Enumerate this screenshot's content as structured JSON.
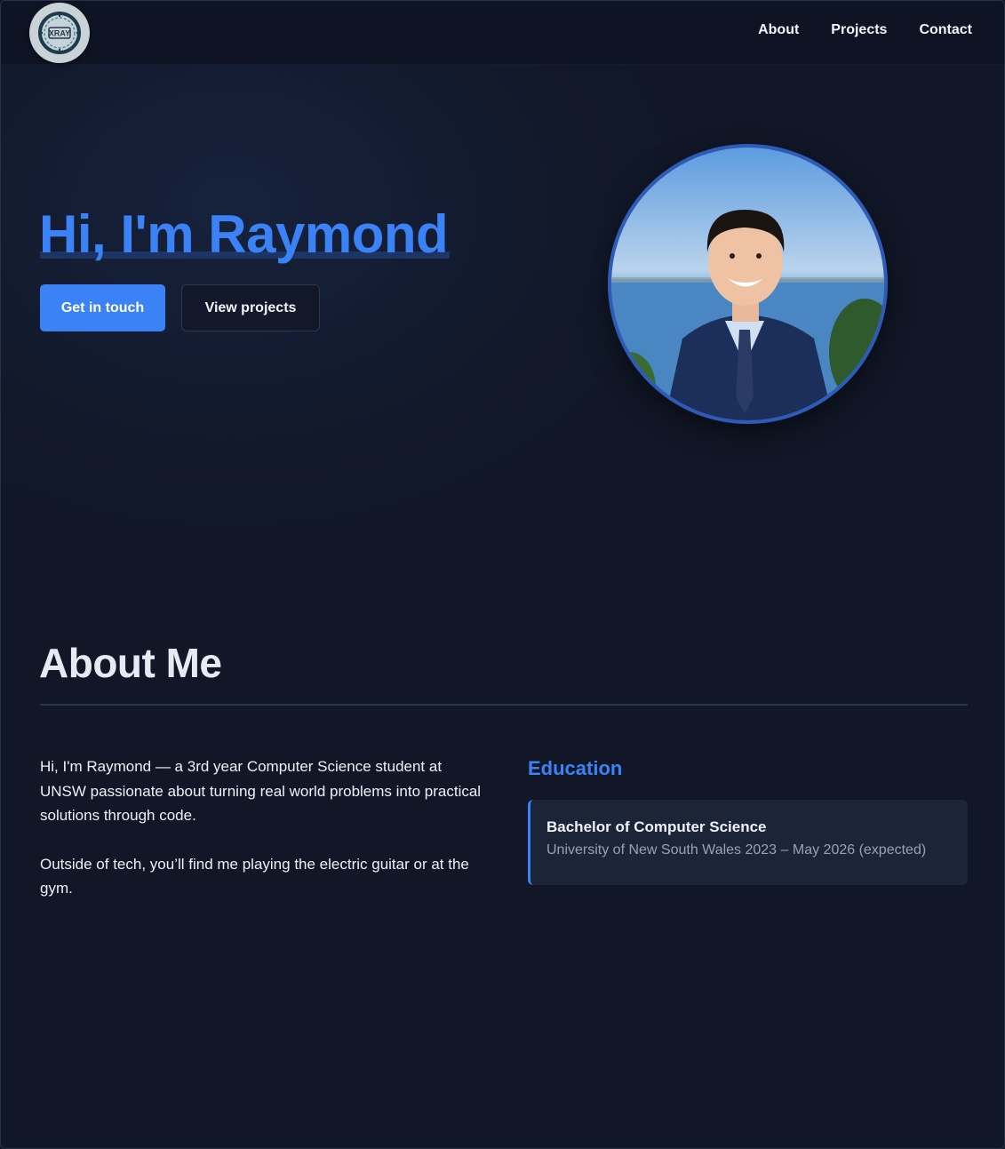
{
  "header": {
    "logo_text": "XRAY",
    "nav": [
      {
        "label": "About"
      },
      {
        "label": "Projects"
      },
      {
        "label": "Contact"
      }
    ]
  },
  "hero": {
    "title": "Hi, I'm Raymond",
    "primary_button": "Get in touch",
    "secondary_button": "View projects",
    "avatar_icon": "profile-photo"
  },
  "about": {
    "title": "About Me",
    "paragraphs": [
      "Hi, I'm Raymond — a 3rd year Computer Science student at UNSW passionate about turning real world problems into practical solutions through code.",
      "Outside of tech, you’ll find me playing the electric guitar or at the gym."
    ],
    "education": {
      "heading": "Education",
      "degree": "Bachelor of Computer Science",
      "detail": "University of New South Wales 2023 – May 2026 (expected)"
    }
  },
  "colors": {
    "accent": "#3b82f6",
    "background": "#111727",
    "card": "#1c2538"
  }
}
